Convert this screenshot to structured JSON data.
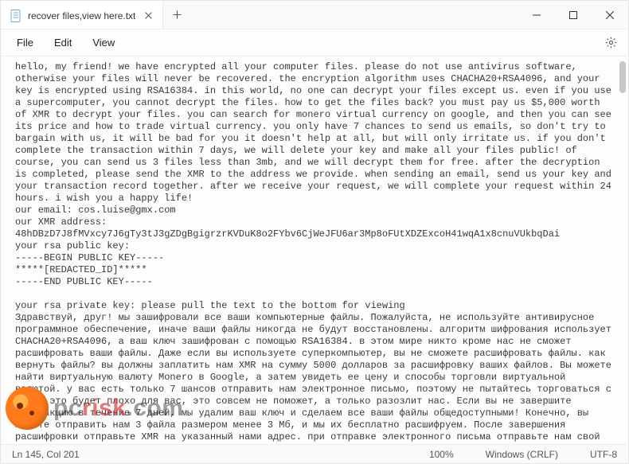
{
  "window": {
    "tab_title": "recover files,view here.txt"
  },
  "menu": {
    "file": "File",
    "edit": "Edit",
    "view": "View"
  },
  "body_text": "hello, my friend! we have encrypted all your computer files. please do not use antivirus software, otherwise your files will never be recovered. the encryption algorithm uses CHACHA20+RSA4096, and your key is encrypted using RSA16384. in this world, no one can decrypt your files except us. even if you use a supercomputer, you cannot decrypt the files. how to get the files back? you must pay us $5,000 worth of XMR to decrypt your files. you can search for monero virtual currency on google, and then you can see its price and how to trade virtual currency. you only have 7 chances to send us emails, so don't try to bargain with us, it will be bad for you it doesn't help at all, but will only irritate us. if you don't complete the transaction within 7 days, we will delete your key and make all your files public! of course, you can send us 3 files less than 3mb, and we will decrypt them for free. after the decryption is completed, please send the XMR to the address we provide. when sending an email, send us your key and your transaction record together. after we receive your request, we will complete your request within 24 hours. i wish you a happy life!\nour email: cos.luise@gmx.com\nour XMR address:\n48hDBzD7J8fMVxcy7J6gTy3tJ3gZDgBgigrzrKVDuK8o2FYbv6CjWeJFU6ar3Mp8oFUtXDZExcoH41wqA1x8cnuVUkbqDai\nyour rsa public key:\n-----BEGIN PUBLIC KEY-----\n*****[REDACTED_ID]*****\n-----END PUBLIC KEY-----\n\nyour rsa private key: please pull the text to the bottom for viewing\nЗдравствуй, друг! мы зашифровали все ваши компьютерные файлы. Пожалуйста, не используйте антивирусное программное обеспечение, иначе ваши файлы никогда не будут восстановлены. алгоритм шифрования использует CHACHA20+RSA4096, а ваш ключ зашифрован с помощью RSA16384. в этом мире никто кроме нас не сможет расшифровать ваши файлы. Даже если вы используете суперкомпьютер, вы не сможете расшифровать файлы. как вернуть файлы? вы должны заплатить нам XMR на сумму 5000 долларов за расшифровку ваших файлов. Вы можете найти виртуальную валюту Monero в Google, а затем увидеть ее цену и способы торговли виртуальной валютой. у вас есть только 7 шансов отправить нам электронное письмо, поэтому не пытайтесь торговаться с нами, это будет плохо для вас, это совсем не поможет, а только разозлит нас. Если вы не завершите транзакцию в течение 7 дней, мы удалим ваш ключ и сделаем все ваши файлы общедоступными! Конечно, вы можете отправить нам 3 файла размером менее 3 Мб, и мы их бесплатно расшифруем. После завершения расшифровки отправьте XMR на указанный нами адрес. при отправке электронного письма отправьте нам свой ключ и запись транзакции вместе. после получения вашего запроса мы выполним ваш запрос в течение 24 часов. желаю тебе счастливой жизни!",
  "status": {
    "position": "Ln 145, Col 201",
    "zoom": "100%",
    "line_ending": "Windows (CRLF)",
    "encoding": "UTF-8"
  },
  "watermark": {
    "pc": "pc",
    "risk": "risk",
    "dotcom": ".com"
  }
}
